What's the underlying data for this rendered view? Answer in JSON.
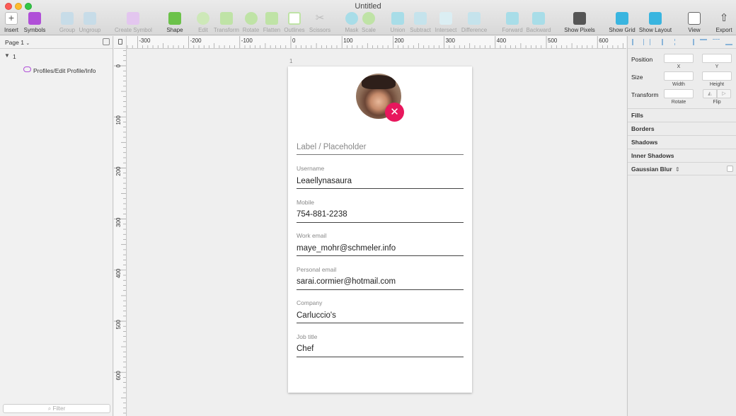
{
  "window": {
    "title": "Untitled"
  },
  "toolbar": {
    "insert": "Insert",
    "symbols": "Symbols",
    "group": "Group",
    "ungroup": "Ungroup",
    "create_symbol": "Create Symbol",
    "shape": "Shape",
    "edit": "Edit",
    "transform": "Transform",
    "rotate": "Rotate",
    "flatten": "Flatten",
    "outlines": "Outlines",
    "scissors": "Scissors",
    "mask": "Mask",
    "scale": "Scale",
    "union": "Union",
    "subtract": "Subtract",
    "intersect": "Intersect",
    "difference": "Difference",
    "forward": "Forward",
    "backward": "Backward",
    "show_pixels": "Show Pixels",
    "show_grid": "Show Grid",
    "show_layout": "Show Layout",
    "view": "View",
    "export": "Export"
  },
  "layers": {
    "page_selector": "Page 1",
    "group_name": "1",
    "artboard_layer": "Profiles/Edit Profile/Info",
    "filter_placeholder": "Filter"
  },
  "rulers": {
    "h_labels": [
      "-300",
      "-200",
      "-100",
      "0",
      "100",
      "200",
      "300",
      "400",
      "500",
      "600"
    ],
    "v_labels": [
      "0",
      "100",
      "200",
      "300",
      "400",
      "500",
      "600"
    ]
  },
  "artboard": {
    "label": "1",
    "placeholder": "Label / Placeholder",
    "fields": [
      {
        "label": "Username",
        "value": "Leaellynasaura"
      },
      {
        "label": "Mobile",
        "value": "754-881-2238"
      },
      {
        "label": "Work email",
        "value": "maye_mohr@schmeler.info"
      },
      {
        "label": "Personal email",
        "value": "sarai.cormier@hotmail.com"
      },
      {
        "label": "Company",
        "value": "Carluccio's"
      },
      {
        "label": "Job title",
        "value": "Chef"
      }
    ]
  },
  "inspector": {
    "position": "Position",
    "x": "X",
    "y": "Y",
    "size": "Size",
    "width": "Width",
    "height": "Height",
    "transform": "Transform",
    "rotate": "Rotate",
    "flip": "Flip",
    "fills": "Fills",
    "borders": "Borders",
    "shadows": "Shadows",
    "inner_shadows": "Inner Shadows",
    "gaussian_blur": "Gaussian Blur"
  },
  "colors": {
    "accent": "#e8175d",
    "selection": "#4a90d9",
    "grid": "#39b5e0"
  }
}
